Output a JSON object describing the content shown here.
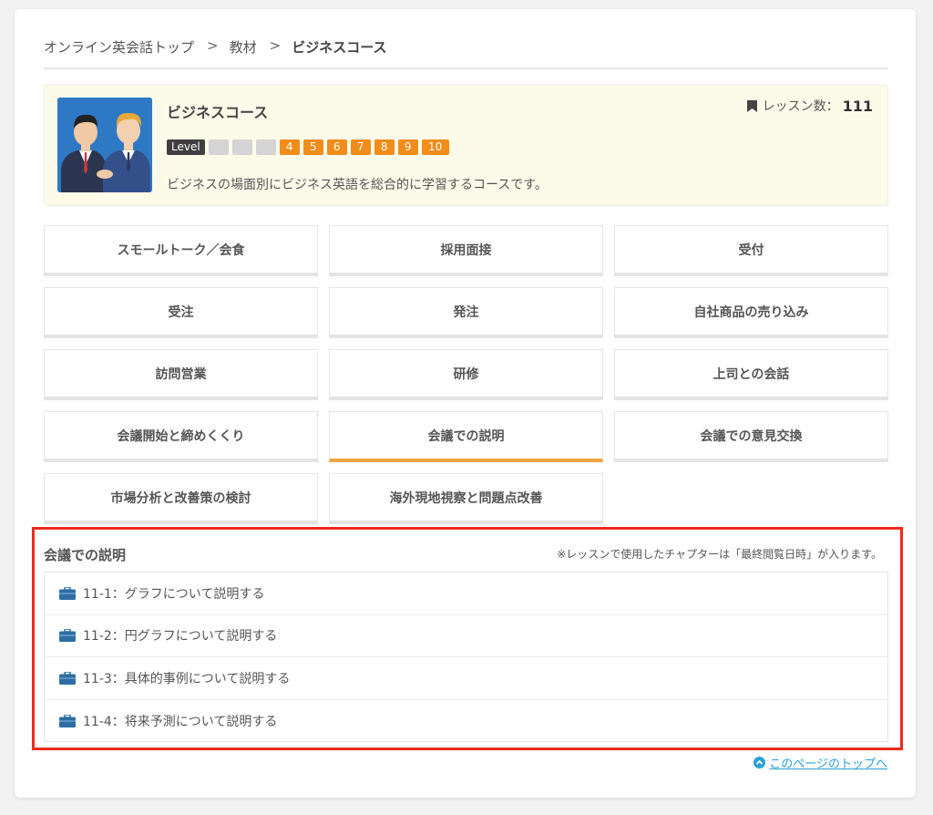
{
  "breadcrumb": {
    "items": [
      "オンライン英会話トップ",
      "教材"
    ],
    "separator": ">",
    "current": "ビジネスコース"
  },
  "course": {
    "title": "ビジネスコース",
    "lesson_count_label": "レッスン数：",
    "lesson_count": "111",
    "level_label": "Level",
    "levels": [
      {
        "text": "",
        "active": false
      },
      {
        "text": "",
        "active": false
      },
      {
        "text": "",
        "active": false
      },
      {
        "text": "4",
        "active": true
      },
      {
        "text": "5",
        "active": true
      },
      {
        "text": "6",
        "active": true
      },
      {
        "text": "7",
        "active": true
      },
      {
        "text": "8",
        "active": true
      },
      {
        "text": "9",
        "active": true
      },
      {
        "text": "10",
        "active": true
      }
    ],
    "description": "ビジネスの場面別にビジネス英語を総合的に学習するコースです。"
  },
  "chapters": [
    "スモールトーク／会食",
    "採用面接",
    "受付",
    "受注",
    "発注",
    "自社商品の売り込み",
    "訪問営業",
    "研修",
    "上司との会話",
    "会議開始と締めくくり",
    "会議での説明",
    "会議での意見交換",
    "市場分析と改善策の検討",
    "海外現地視察と問題点改善"
  ],
  "active_chapter_index": 10,
  "lessons_section": {
    "title": "会議での説明",
    "note": "※レッスンで使用したチャプターは「最終閲覧日時」が入ります。",
    "items": [
      "11-1：グラフについて説明する",
      "11-2：円グラフについて説明する",
      "11-3：具体的事例について説明する",
      "11-4：将来予測について説明する"
    ]
  },
  "footer": {
    "to_top": "このページのトップへ"
  },
  "colors": {
    "accent": "#f28c1a",
    "active_border": "#f5a447",
    "highlight": "#ee2a1d",
    "link": "#2aa0d6"
  }
}
